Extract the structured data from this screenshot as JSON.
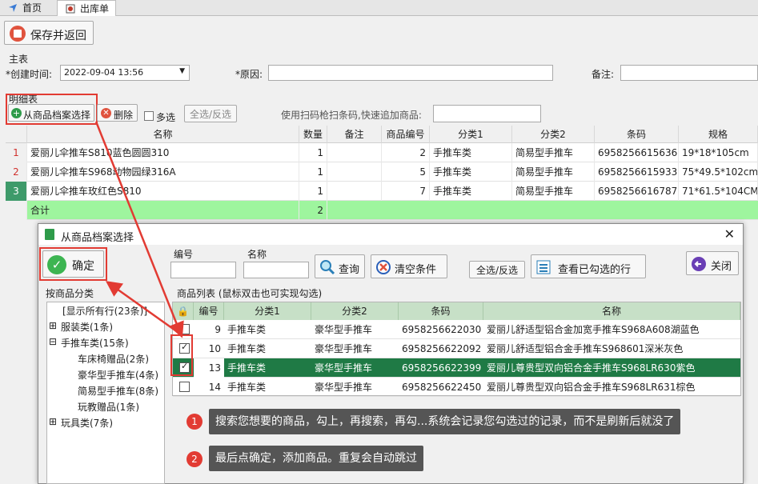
{
  "tabs": [
    {
      "label": "首页"
    },
    {
      "label": "出库单"
    }
  ],
  "toolbar": {
    "save_return": "保存并返回"
  },
  "main_section": {
    "title": "主表",
    "created_label": "*创建时间:",
    "created_value": "2022-09-04 13:56",
    "reason_label": "*原因:",
    "reason_value": "",
    "remark_label": "备注:",
    "remark_value": ""
  },
  "detail_section": {
    "title": "明细表",
    "select_from_archive": "从商品档案选择",
    "delete": "删除",
    "multi": "多选",
    "select_all": "全选/反选",
    "scan_label": "使用扫码枪扫条码,快速追加商品:",
    "scan_value": ""
  },
  "detail_grid": {
    "headers": [
      "名称",
      "数量",
      "备注",
      "商品编号",
      "分类1",
      "分类2",
      "条码",
      "规格"
    ],
    "rows": [
      {
        "num": "1",
        "name": "爱丽儿伞推车S810蓝色圆圆310",
        "qty": "1",
        "remark": "",
        "code": "2",
        "cat1": "手推车类",
        "cat2": "简易型手推车",
        "barcode": "6958256615636",
        "spec": "19*18*105cm"
      },
      {
        "num": "2",
        "name": "爱丽儿伞推车S968动物园绿316A",
        "qty": "1",
        "remark": "",
        "code": "5",
        "cat1": "手推车类",
        "cat2": "简易型手推车",
        "barcode": "6958256615933",
        "spec": "75*49.5*102cm"
      },
      {
        "num": "3",
        "name": "爱丽儿伞推车玫红色S810",
        "qty": "1",
        "remark": "",
        "code": "7",
        "cat1": "手推车类",
        "cat2": "简易型手推车",
        "barcode": "6958256616787",
        "spec": "71*61.5*104CM"
      }
    ],
    "sum_label": "合计",
    "sum_qty": "2"
  },
  "dialog": {
    "title": "从商品档案选择",
    "confirm": "确定",
    "code_label": "编号",
    "code_value": "",
    "name_label": "名称",
    "name_value": "",
    "query": "查询",
    "clear": "清空条件",
    "select_all": "全选/反选",
    "view_checked": "查看已勾选的行",
    "close": "关闭",
    "tree_title": "按商品分类",
    "tree": [
      {
        "label": "[显示所有行(23条)]"
      },
      {
        "label": "服装类(1条)"
      },
      {
        "label": "手推车类(15条)"
      },
      {
        "label": "车床椅赠品(2条)"
      },
      {
        "label": "豪华型手推车(4条)"
      },
      {
        "label": "简易型手推车(8条)"
      },
      {
        "label": "玩教赠品(1条)"
      },
      {
        "label": "玩具类(7条)"
      }
    ],
    "list_title": "商品列表 (鼠标双击也可实现勾选)",
    "list_headers": [
      "编号",
      "分类1",
      "分类2",
      "条码",
      "名称"
    ],
    "list_rows": [
      {
        "checked": false,
        "code": "9",
        "cat1": "手推车类",
        "cat2": "豪华型手推车",
        "barcode": "6958256622030",
        "name": "爱丽儿舒适型铝合金加宽手推车S968A608湖蓝色"
      },
      {
        "checked": true,
        "code": "10",
        "cat1": "手推车类",
        "cat2": "豪华型手推车",
        "barcode": "6958256622092",
        "name": "爱丽儿舒适型铝合金手推车S968601深米灰色"
      },
      {
        "checked": true,
        "code": "13",
        "cat1": "手推车类",
        "cat2": "豪华型手推车",
        "barcode": "6958256622399",
        "name": "爱丽儿尊贵型双向铝合金手推车S968LR630紫色"
      },
      {
        "checked": false,
        "code": "14",
        "cat1": "手推车类",
        "cat2": "豪华型手推车",
        "barcode": "6958256622450",
        "name": "爱丽儿尊贵型双向铝合金手推车S968LR631棕色"
      }
    ]
  },
  "annotations": [
    {
      "num": "1",
      "text": "搜索您想要的商品，勾上，再搜索，再勾...系统会记录您勾选过的记录，而不是刷新后就没了"
    },
    {
      "num": "2",
      "text": "最后点确定，添加商品。重复会自动跳过"
    }
  ],
  "colors": {
    "accent_red": "#e23b33",
    "selected_row": "#1f7a45",
    "sum_row": "#9ef59e",
    "list_header": "#c7e0c7"
  }
}
